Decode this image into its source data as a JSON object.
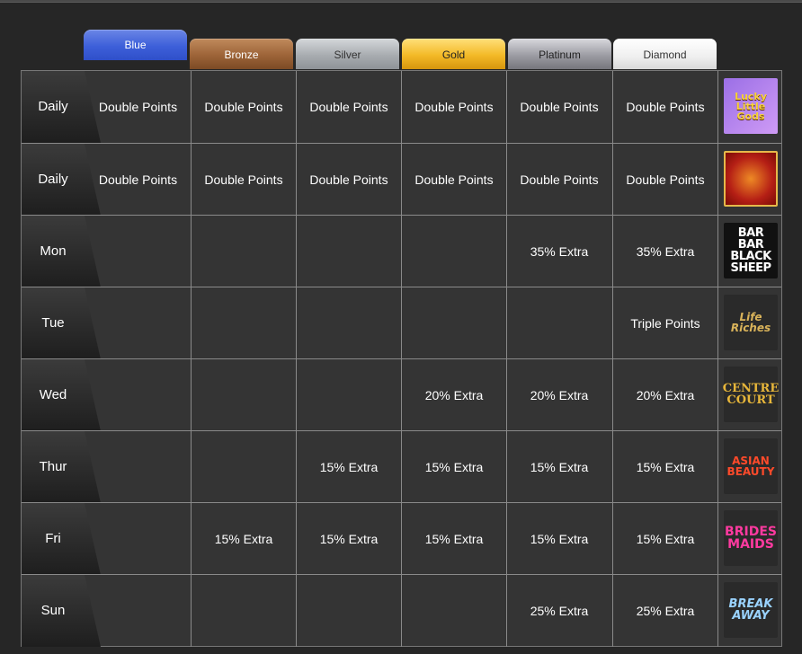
{
  "tiers": [
    {
      "key": "blue",
      "label": "Blue"
    },
    {
      "key": "bronze",
      "label": "Bronze"
    },
    {
      "key": "silver",
      "label": "Silver"
    },
    {
      "key": "gold",
      "label": "Gold"
    },
    {
      "key": "platinum",
      "label": "Platinum"
    },
    {
      "key": "diamond",
      "label": "Diamond"
    }
  ],
  "rows": [
    {
      "day": "Daily",
      "cells": [
        "Double Points",
        "Double Points",
        "Double Points",
        "Double Points",
        "Double Points",
        "Double Points"
      ],
      "logo": {
        "icon": "lucky-little-gods-logo",
        "text": "Lucky Little Gods"
      }
    },
    {
      "day": "Daily",
      "cells": [
        "Double Points",
        "Double Points",
        "Double Points",
        "Double Points",
        "Double Points",
        "Double Points"
      ],
      "logo": {
        "icon": "ruby-logo",
        "text": ""
      }
    },
    {
      "day": "Mon",
      "cells": [
        "",
        "",
        "",
        "",
        "35% Extra",
        "35% Extra"
      ],
      "logo": {
        "icon": "black-sheep-logo",
        "text": "BAR BAR BLACK SHEEP"
      }
    },
    {
      "day": "Tue",
      "cells": [
        "",
        "",
        "",
        "",
        "",
        "Triple Points"
      ],
      "logo": {
        "icon": "life-of-riches-logo",
        "text": "Life Riches"
      }
    },
    {
      "day": "Wed",
      "cells": [
        "",
        "",
        "",
        "20% Extra",
        "20% Extra",
        "20% Extra"
      ],
      "logo": {
        "icon": "centre-court-logo",
        "text": "CENTRE COURT"
      }
    },
    {
      "day": "Thur",
      "cells": [
        "",
        "",
        "15% Extra",
        "15% Extra",
        "15% Extra",
        "15% Extra"
      ],
      "logo": {
        "icon": "asian-beauty-logo",
        "text": "ASIAN BEAUTY"
      }
    },
    {
      "day": "Fri",
      "cells": [
        "",
        "15% Extra",
        "15% Extra",
        "15% Extra",
        "15% Extra",
        "15% Extra"
      ],
      "logo": {
        "icon": "bridesmaids-logo",
        "text": "BRIDES MAIDS"
      }
    },
    {
      "day": "Sun",
      "cells": [
        "",
        "",
        "",
        "",
        "25% Extra",
        "25% Extra"
      ],
      "logo": {
        "icon": "break-away-logo",
        "text": "BREAK AWAY"
      }
    }
  ],
  "colors": {
    "background": "#262626",
    "cell": "#343434",
    "grid_line": "#8a8a8a",
    "blue": "#3d5fd9",
    "bronze": "#9d6438",
    "silver": "#a8acb0",
    "gold": "#f3b927",
    "platinum": "#9c9ca3",
    "diamond": "#efefef"
  }
}
